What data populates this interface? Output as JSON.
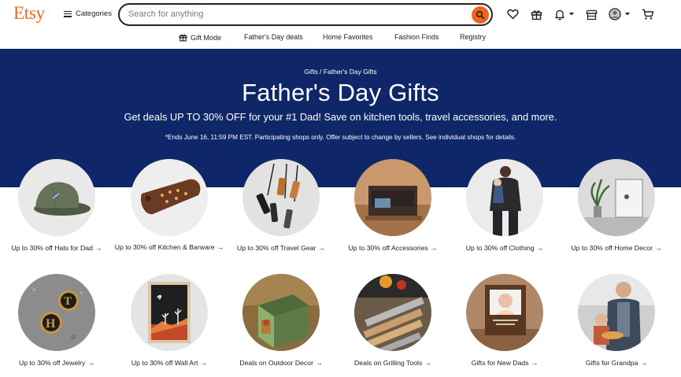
{
  "header": {
    "logo": "Etsy",
    "categories_label": "Categories",
    "search_placeholder": "Search for anything"
  },
  "icons": {
    "search": "search-icon",
    "favorites": "heart-icon",
    "gift": "gift-icon",
    "notifications": "bell-icon",
    "shop": "shop-icon",
    "account": "user-avatar-icon",
    "cart": "cart-icon"
  },
  "subnav": {
    "items": [
      "Gift Mode",
      "Father's Day deals",
      "Home Favorites",
      "Fashion Finds",
      "Registry"
    ]
  },
  "banner": {
    "breadcrumb": "Gifts / Father's Day Gifts",
    "title": "Father's Day Gifts",
    "subtitle": "Get deals UP TO 30% OFF for your #1 Dad! Save on kitchen tools, travel accessories, and more.",
    "fine_print": "*Ends June 16, 11:59 PM EST. Participating shops only. Offer subject to change by sellers. See individual shops for details."
  },
  "colors": {
    "brand": "#f1641e",
    "banner_bg": "#0f2769"
  },
  "cards": [
    {
      "label": "Up to 30% off Hats for Dad"
    },
    {
      "label": "Up to 30% off Kitchen & Barware"
    },
    {
      "label": "Up to 30% off Travel Gear"
    },
    {
      "label": "Up to 30% off Accessories"
    },
    {
      "label": "Up to 30% off Clothing"
    },
    {
      "label": "Up to 30% off Home Decor"
    },
    {
      "label": "Up to 30% off Jewelry"
    },
    {
      "label": "Up to 30% off Wall Art"
    },
    {
      "label": "Deals on Outdoor Decor"
    },
    {
      "label": "Deals on Grilling Tools"
    },
    {
      "label": "Gifts for New Dads"
    },
    {
      "label": "Gifts for Grandpa"
    }
  ],
  "arrow_glyph": "→"
}
